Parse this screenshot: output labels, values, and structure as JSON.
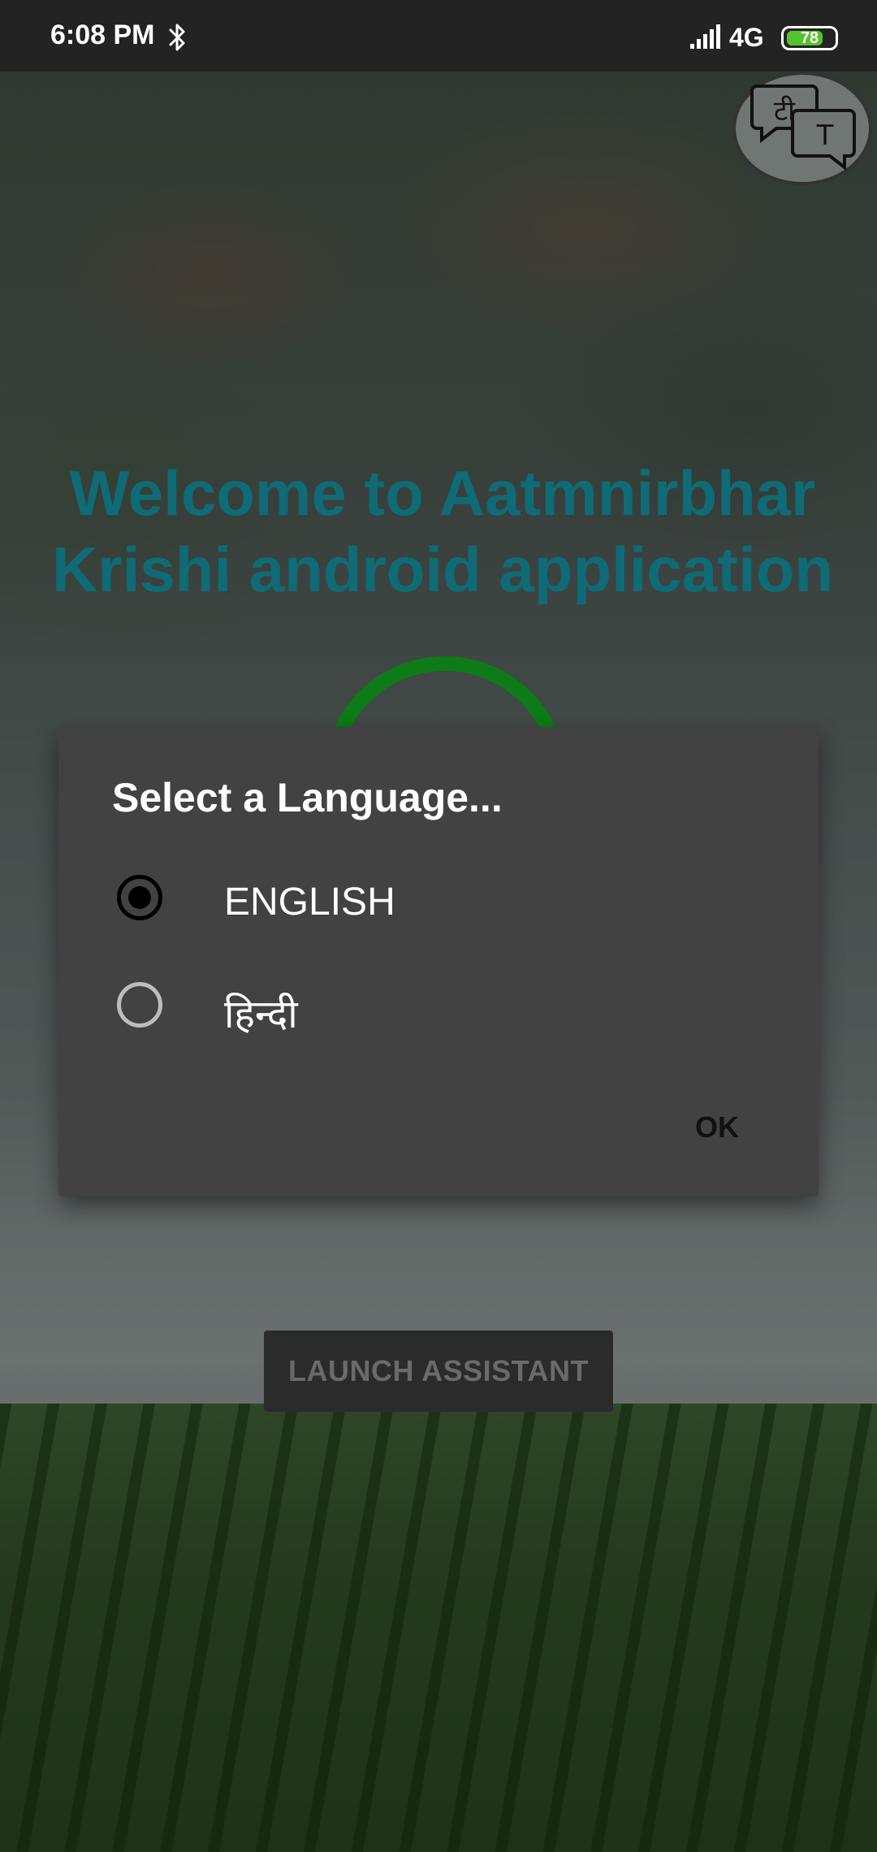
{
  "status_bar": {
    "time": "6:08 PM",
    "network": "4G",
    "battery": "78",
    "battery_fraction": 0.78,
    "icons": [
      "bluetooth-icon",
      "signal-icon",
      "battery-icon"
    ]
  },
  "top_right_icon": "translate-icon",
  "welcome": {
    "line1": "Welcome to Aatmnirbhar",
    "line2": "Krishi android application"
  },
  "dialog": {
    "title": "Select a Language...",
    "options": [
      {
        "label": "ENGLISH",
        "selected": true
      },
      {
        "label": "हिन्दी",
        "selected": false
      }
    ],
    "ok_label": "OK"
  },
  "launch_button": "LAUNCH ASSISTANT",
  "colors": {
    "heading": "#0f6b76",
    "dialog_bg": "#424242",
    "ring": "#0d7b17",
    "battery": "#56c12f"
  }
}
